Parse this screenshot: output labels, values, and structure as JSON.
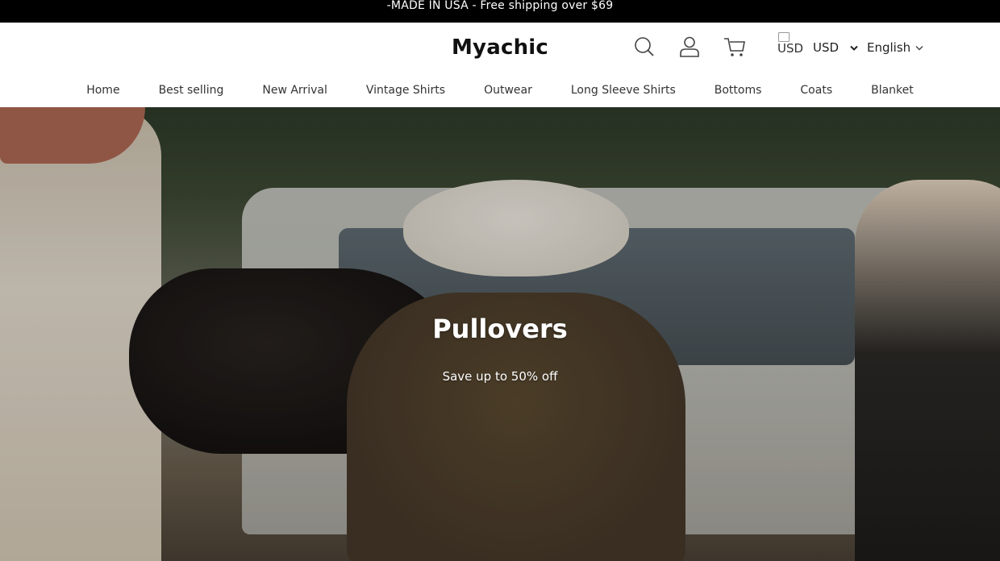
{
  "announcement": "-MADE IN USA - Free shipping over $69",
  "header": {
    "logo": "Myachic",
    "currency_flag_alt": "USD",
    "currency": "USD",
    "language": "English",
    "icons": [
      "search-icon",
      "account-icon",
      "cart-icon"
    ]
  },
  "nav": {
    "items": [
      "Home",
      "Best selling",
      "New Arrival",
      "Vintage Shirts",
      "Outwear",
      "Long Sleeve Shirts",
      "Bottoms",
      "Coats",
      "Blanket"
    ]
  },
  "hero": {
    "title": "Pullovers",
    "subtitle": "Save up to 50% off"
  }
}
